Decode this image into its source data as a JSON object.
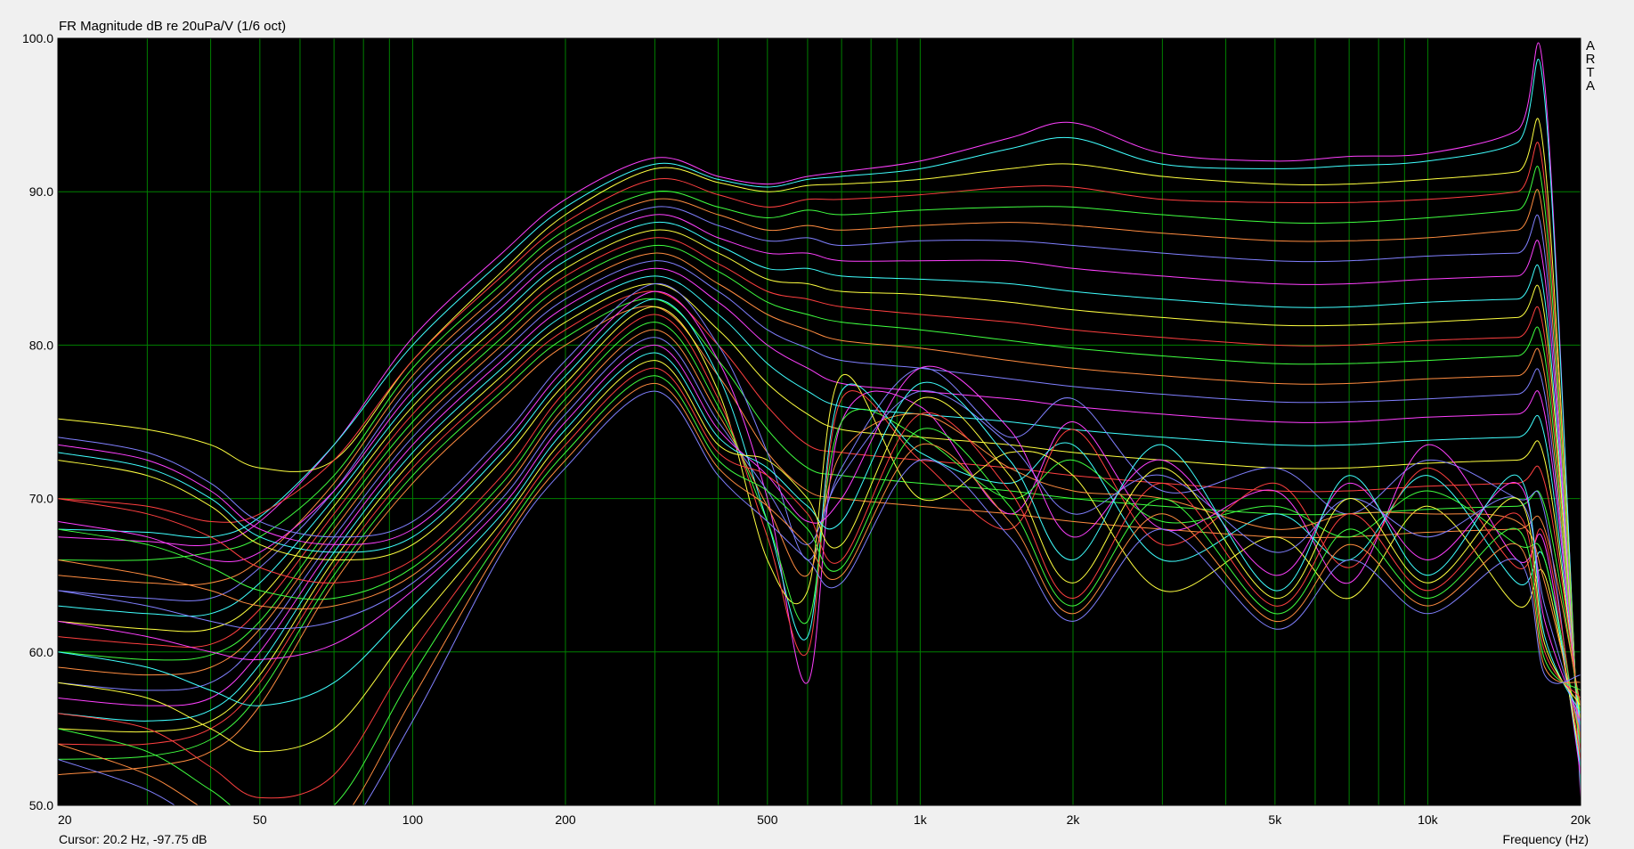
{
  "window": {
    "title": "FR Magnitude dB re 20uPa/V (1/6 oct)",
    "cursor_readout": "Cursor: 20.2 Hz, -97.75 dB",
    "watermark_letters": [
      "A",
      "R",
      "T",
      "A"
    ]
  },
  "chart_data": {
    "type": "line",
    "title": "FR Magnitude dB re 20uPa/V (1/6 oct)",
    "xlabel": "Frequency (Hz)",
    "ylabel": "",
    "x_scale": "log",
    "xlim": [
      20,
      20000
    ],
    "ylim": [
      50,
      100
    ],
    "x_ticks": [
      {
        "value": 20,
        "label": "20"
      },
      {
        "value": 50,
        "label": "50"
      },
      {
        "value": 100,
        "label": "100"
      },
      {
        "value": 200,
        "label": "200"
      },
      {
        "value": 500,
        "label": "500"
      },
      {
        "value": 1000,
        "label": "1k"
      },
      {
        "value": 2000,
        "label": "2k"
      },
      {
        "value": 5000,
        "label": "5k"
      },
      {
        "value": 10000,
        "label": "10k"
      },
      {
        "value": 20000,
        "label": "20k"
      }
    ],
    "y_ticks": [
      {
        "value": 50,
        "label": "50.0"
      },
      {
        "value": 60,
        "label": "60.0"
      },
      {
        "value": 70,
        "label": "70.0"
      },
      {
        "value": 80,
        "label": "80.0"
      },
      {
        "value": 90,
        "label": "90.0"
      },
      {
        "value": 100,
        "label": "100.0"
      }
    ],
    "grid": true,
    "background": "#000000",
    "grid_color": "#008000",
    "x": [
      20,
      30,
      40,
      50,
      70,
      100,
      150,
      200,
      300,
      400,
      500,
      600,
      700,
      1000,
      1500,
      2000,
      3000,
      5000,
      7000,
      10000,
      15000,
      17000,
      20000
    ],
    "series": [
      {
        "color": "#ff40ff",
        "values": [
          67.5,
          67.2,
          67.0,
          68.5,
          73.5,
          80.5,
          86.0,
          89.5,
          92.2,
          91.0,
          90.5,
          91.0,
          91.3,
          92.0,
          93.5,
          94.5,
          92.5,
          92.0,
          92.3,
          92.5,
          94.0,
          97.0,
          50.5
        ]
      },
      {
        "color": "#40ffff",
        "values": [
          68.0,
          67.8,
          67.5,
          68.8,
          73.5,
          80.0,
          85.5,
          89.0,
          91.8,
          90.8,
          90.3,
          90.8,
          91.0,
          91.5,
          92.8,
          93.5,
          91.8,
          91.5,
          91.7,
          92.0,
          93.2,
          96.0,
          51.0
        ]
      },
      {
        "color": "#ffff40",
        "values": [
          75.2,
          74.5,
          73.5,
          72.0,
          72.5,
          79.0,
          84.8,
          88.5,
          91.5,
          90.6,
          90.0,
          90.4,
          90.5,
          90.8,
          91.5,
          91.8,
          91.0,
          90.5,
          90.5,
          90.8,
          91.3,
          92.0,
          52.0
        ]
      },
      {
        "color": "#ff4040",
        "values": [
          70.0,
          69.5,
          68.5,
          69.0,
          72.5,
          79.0,
          84.5,
          88.0,
          90.8,
          89.8,
          89.0,
          89.5,
          89.5,
          89.8,
          90.3,
          90.3,
          89.5,
          89.3,
          89.3,
          89.5,
          90.0,
          90.5,
          52.0
        ]
      },
      {
        "color": "#40ff40",
        "values": [
          66.0,
          66.0,
          66.5,
          67.5,
          71.5,
          78.5,
          84.0,
          87.5,
          90.0,
          89.0,
          88.3,
          88.8,
          88.5,
          88.8,
          89.0,
          89.0,
          88.5,
          88.0,
          88.0,
          88.3,
          88.8,
          89.0,
          52.5
        ]
      },
      {
        "color": "#ff8c40",
        "values": [
          65.0,
          64.5,
          64.5,
          66.0,
          71.0,
          78.0,
          83.5,
          87.0,
          89.5,
          88.5,
          87.5,
          87.8,
          87.5,
          87.8,
          88.0,
          87.8,
          87.3,
          86.8,
          86.8,
          87.0,
          87.5,
          87.5,
          52.0
        ]
      },
      {
        "color": "#8080ff",
        "values": [
          64.0,
          63.5,
          63.5,
          65.5,
          70.5,
          77.5,
          83.0,
          86.5,
          89.0,
          87.8,
          86.8,
          87.0,
          86.5,
          86.8,
          86.8,
          86.5,
          86.0,
          85.5,
          85.5,
          85.8,
          86.0,
          86.0,
          52.5
        ]
      },
      {
        "color": "#ff40ff",
        "values": [
          68.5,
          67.5,
          66.0,
          66.5,
          70.5,
          77.0,
          82.5,
          86.0,
          88.5,
          87.0,
          86.0,
          86.0,
          85.5,
          85.5,
          85.5,
          85.0,
          84.5,
          84.0,
          84.0,
          84.3,
          84.5,
          84.5,
          53.0
        ]
      },
      {
        "color": "#40ffff",
        "values": [
          63.0,
          62.5,
          62.5,
          64.5,
          70.0,
          76.5,
          82.0,
          85.5,
          88.0,
          86.5,
          85.0,
          85.0,
          84.5,
          84.3,
          84.0,
          83.5,
          83.0,
          82.5,
          82.5,
          82.8,
          83.0,
          83.0,
          53.0
        ]
      },
      {
        "color": "#ffff40",
        "values": [
          62.0,
          61.5,
          61.5,
          63.5,
          69.5,
          76.0,
          81.5,
          85.0,
          87.5,
          86.0,
          84.3,
          84.0,
          83.5,
          83.3,
          82.8,
          82.3,
          81.8,
          81.3,
          81.3,
          81.5,
          81.8,
          81.8,
          53.5
        ]
      },
      {
        "color": "#ff4040",
        "values": [
          61.0,
          60.5,
          60.5,
          62.8,
          69.0,
          75.5,
          81.0,
          84.5,
          87.0,
          85.3,
          83.5,
          83.0,
          82.5,
          82.0,
          81.5,
          81.0,
          80.5,
          80.0,
          80.0,
          80.3,
          80.5,
          80.5,
          53.5
        ]
      },
      {
        "color": "#40ff40",
        "values": [
          60.0,
          59.5,
          59.8,
          62.0,
          68.5,
          75.0,
          80.5,
          84.0,
          86.5,
          84.8,
          82.8,
          82.0,
          81.5,
          81.0,
          80.3,
          79.8,
          79.3,
          78.8,
          78.8,
          79.0,
          79.3,
          79.3,
          54.0
        ]
      },
      {
        "color": "#ff8c40",
        "values": [
          59.0,
          58.5,
          59.0,
          61.5,
          68.0,
          74.5,
          80.0,
          83.5,
          86.0,
          84.0,
          82.0,
          81.0,
          80.3,
          79.8,
          79.0,
          78.5,
          78.0,
          77.5,
          77.5,
          77.8,
          78.0,
          78.0,
          54.0
        ]
      },
      {
        "color": "#8080ff",
        "values": [
          58.0,
          57.5,
          58.0,
          60.8,
          67.5,
          74.0,
          79.5,
          83.0,
          85.5,
          83.5,
          81.0,
          79.8,
          79.0,
          78.5,
          77.8,
          77.3,
          76.8,
          76.3,
          76.3,
          76.5,
          76.8,
          76.8,
          54.5
        ]
      },
      {
        "color": "#ff40ff",
        "values": [
          57.0,
          56.5,
          57.0,
          60.0,
          67.0,
          73.5,
          79.0,
          82.5,
          85.0,
          82.8,
          80.0,
          78.5,
          77.5,
          77.0,
          76.5,
          76.0,
          75.5,
          75.0,
          75.0,
          75.3,
          75.5,
          75.5,
          55.0
        ]
      },
      {
        "color": "#40ffff",
        "values": [
          56.0,
          55.5,
          56.2,
          59.2,
          66.5,
          73.0,
          78.5,
          82.0,
          84.5,
          82.0,
          78.8,
          77.0,
          76.0,
          75.5,
          75.0,
          74.5,
          74.0,
          73.5,
          73.5,
          73.8,
          74.0,
          74.0,
          55.0
        ]
      },
      {
        "color": "#ffff40",
        "values": [
          55.0,
          54.8,
          55.5,
          58.5,
          66.0,
          72.5,
          78.0,
          81.5,
          84.0,
          81.0,
          77.5,
          75.5,
          74.5,
          74.0,
          73.5,
          73.0,
          72.5,
          72.0,
          72.0,
          72.3,
          72.5,
          72.5,
          55.5
        ]
      },
      {
        "color": "#ff4040",
        "values": [
          54.0,
          54.0,
          55.0,
          58.0,
          65.5,
          72.0,
          77.5,
          81.0,
          83.5,
          80.0,
          76.0,
          73.5,
          73.0,
          72.5,
          72.0,
          71.5,
          71.0,
          70.5,
          70.5,
          70.8,
          71.0,
          71.0,
          56.0
        ]
      },
      {
        "color": "#40ff40",
        "values": [
          53.0,
          53.2,
          54.3,
          57.3,
          65.0,
          71.5,
          77.0,
          80.5,
          83.0,
          79.0,
          74.5,
          72.0,
          71.5,
          71.0,
          70.5,
          70.0,
          69.5,
          69.0,
          69.0,
          69.3,
          69.5,
          69.5,
          56.0
        ]
      },
      {
        "color": "#ff8c40",
        "values": [
          52.0,
          52.5,
          53.5,
          56.5,
          64.5,
          71.0,
          76.5,
          80.0,
          82.5,
          78.0,
          73.0,
          70.5,
          70.0,
          69.5,
          69.0,
          68.5,
          68.0,
          67.5,
          67.5,
          67.8,
          68.0,
          68.0,
          56.5
        ]
      },
      {
        "color": "#8080ff",
        "values": [
          74.0,
          73.0,
          71.0,
          68.5,
          67.5,
          68.5,
          74.0,
          79.0,
          84.0,
          80.0,
          73.0,
          66.0,
          72.0,
          78.5,
          74.0,
          76.5,
          70.5,
          72.0,
          69.0,
          72.5,
          70.0,
          69.0,
          52.0
        ]
      },
      {
        "color": "#ff40ff",
        "values": [
          73.5,
          72.5,
          70.5,
          68.0,
          67.0,
          68.0,
          73.5,
          78.5,
          83.5,
          79.0,
          70.0,
          58.0,
          75.0,
          76.0,
          69.0,
          75.0,
          68.0,
          70.5,
          64.5,
          73.5,
          66.0,
          67.0,
          52.0
        ]
      },
      {
        "color": "#40ffff",
        "values": [
          73.0,
          72.0,
          70.0,
          67.5,
          66.5,
          67.5,
          73.0,
          78.0,
          83.0,
          78.0,
          68.5,
          61.0,
          77.0,
          73.0,
          71.0,
          73.5,
          66.0,
          69.0,
          66.0,
          71.5,
          64.5,
          66.0,
          52.5
        ]
      },
      {
        "color": "#ffff40",
        "values": [
          72.5,
          71.5,
          69.5,
          67.0,
          66.0,
          67.0,
          72.5,
          77.5,
          82.5,
          77.0,
          66.0,
          64.0,
          78.0,
          70.0,
          73.0,
          71.5,
          64.0,
          67.5,
          63.5,
          69.5,
          63.0,
          65.0,
          53.0
        ]
      },
      {
        "color": "#ff4040",
        "values": [
          70.0,
          69.0,
          67.5,
          65.5,
          64.5,
          66.0,
          71.5,
          77.0,
          82.0,
          76.5,
          67.5,
          60.0,
          76.5,
          72.5,
          68.0,
          74.5,
          67.0,
          71.0,
          65.5,
          72.0,
          65.5,
          67.5,
          53.0
        ]
      },
      {
        "color": "#40ff40",
        "values": [
          68.0,
          67.0,
          65.5,
          64.0,
          63.5,
          65.5,
          71.0,
          76.5,
          81.5,
          76.0,
          68.5,
          62.0,
          75.0,
          74.0,
          70.0,
          72.5,
          68.5,
          69.5,
          67.5,
          70.5,
          67.0,
          66.0,
          54.0
        ]
      },
      {
        "color": "#ff8c40",
        "values": [
          66.0,
          65.0,
          64.0,
          63.0,
          63.0,
          65.0,
          70.5,
          76.0,
          81.0,
          75.5,
          69.5,
          65.0,
          73.0,
          75.5,
          72.0,
          70.5,
          70.0,
          68.0,
          69.0,
          69.0,
          68.5,
          64.5,
          54.5
        ]
      },
      {
        "color": "#8080ff",
        "values": [
          64.0,
          63.0,
          62.0,
          61.5,
          62.0,
          64.5,
          70.0,
          75.5,
          80.5,
          75.0,
          70.5,
          67.0,
          71.5,
          77.0,
          73.5,
          69.0,
          71.5,
          66.5,
          70.0,
          67.5,
          70.0,
          63.0,
          55.0
        ]
      },
      {
        "color": "#ff40ff",
        "values": [
          62.0,
          61.0,
          60.0,
          59.5,
          60.5,
          64.0,
          69.5,
          75.0,
          80.0,
          74.5,
          71.5,
          68.5,
          70.0,
          78.5,
          74.5,
          67.5,
          72.5,
          65.0,
          71.0,
          66.0,
          71.0,
          62.0,
          55.5
        ]
      },
      {
        "color": "#40ffff",
        "values": [
          60.0,
          59.0,
          57.5,
          56.5,
          58.0,
          63.0,
          69.0,
          74.5,
          79.5,
          74.0,
          72.0,
          69.5,
          68.5,
          77.5,
          72.5,
          66.0,
          73.5,
          64.0,
          71.5,
          65.0,
          71.5,
          61.0,
          56.0
        ]
      },
      {
        "color": "#ffff40",
        "values": [
          58.0,
          57.0,
          55.0,
          53.5,
          55.0,
          61.5,
          68.5,
          74.0,
          79.0,
          73.5,
          72.5,
          70.0,
          67.0,
          76.5,
          71.5,
          64.5,
          72.0,
          63.5,
          70.0,
          64.5,
          70.0,
          60.5,
          56.5
        ]
      },
      {
        "color": "#ff4040",
        "values": [
          56.0,
          55.0,
          52.5,
          50.5,
          52.0,
          60.0,
          68.0,
          73.5,
          78.5,
          73.0,
          71.5,
          69.0,
          66.0,
          75.5,
          70.5,
          63.5,
          71.0,
          63.0,
          69.0,
          64.0,
          69.0,
          60.0,
          57.0
        ]
      },
      {
        "color": "#40ff40",
        "values": [
          55.0,
          53.5,
          51.0,
          49.0,
          50.0,
          58.5,
          67.5,
          73.0,
          78.0,
          72.5,
          70.5,
          68.0,
          65.5,
          74.5,
          69.5,
          63.0,
          70.0,
          62.5,
          68.0,
          63.5,
          68.0,
          59.5,
          57.5
        ]
      },
      {
        "color": "#ff8c40",
        "values": [
          54.0,
          52.0,
          49.5,
          48.0,
          48.5,
          57.0,
          67.0,
          72.5,
          77.5,
          72.0,
          69.5,
          67.0,
          65.0,
          73.5,
          68.5,
          62.5,
          69.0,
          62.0,
          67.0,
          63.0,
          67.0,
          59.0,
          58.0
        ]
      },
      {
        "color": "#8080ff",
        "values": [
          53.0,
          51.0,
          48.5,
          47.0,
          47.5,
          55.5,
          66.5,
          72.0,
          77.0,
          71.5,
          68.5,
          66.0,
          64.5,
          72.5,
          67.5,
          62.0,
          68.0,
          61.5,
          66.0,
          62.5,
          66.0,
          58.5,
          58.5
        ]
      }
    ]
  }
}
